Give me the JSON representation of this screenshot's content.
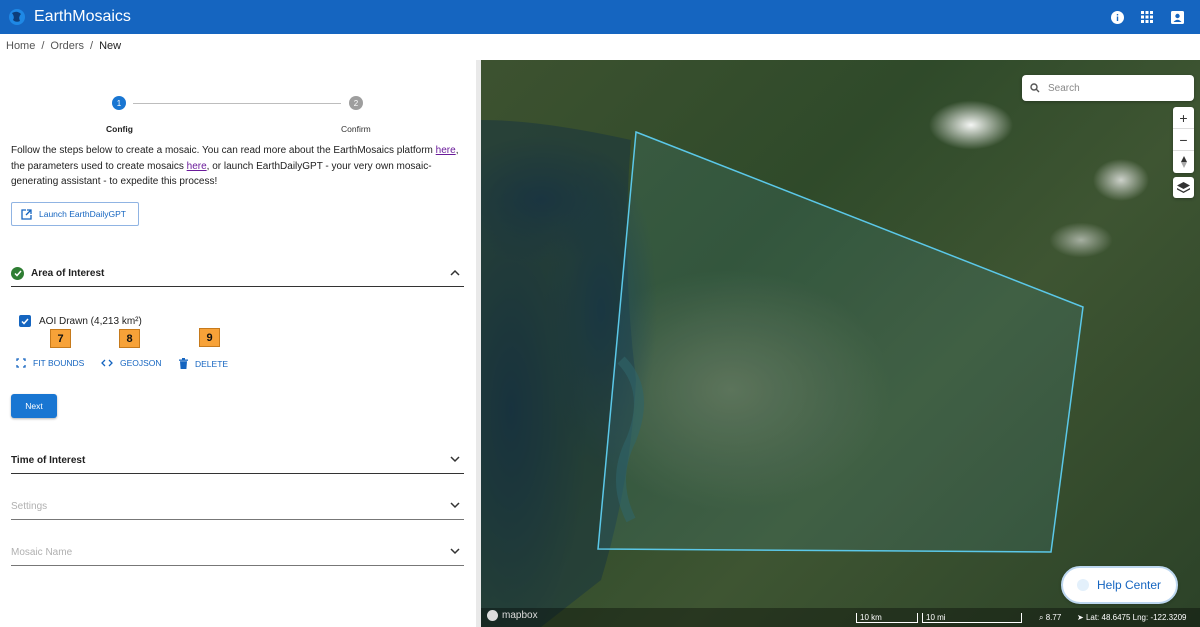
{
  "app": {
    "title": "EarthMosaics"
  },
  "breadcrumb": {
    "items": [
      "Home",
      "Orders",
      "New"
    ],
    "separator": "/"
  },
  "stepper": {
    "steps": [
      {
        "number": "1",
        "label": "Config",
        "active": true
      },
      {
        "number": "2",
        "label": "Confirm",
        "active": false
      }
    ]
  },
  "intro": {
    "part1": "Follow the steps below to create a mosaic. You can read more about the EarthMosaics platform ",
    "link1": "here",
    "part2": ", the parameters used to create mosaics ",
    "link2": "here",
    "part3": ", or launch EarthDailyGPT - your very own mosaic-generating assistant - to expedite this process!"
  },
  "launch_button": {
    "label": "Launch EarthDailyGPT"
  },
  "area_of_interest": {
    "title": "Area of Interest",
    "aoi_label": "AOI Drawn (4,213 km²)",
    "actions": {
      "fit_bounds": "FIT BOUNDS",
      "geojson": "GEOJSON",
      "delete": "DELETE"
    },
    "badges": [
      "7",
      "8",
      "9"
    ]
  },
  "next_button": {
    "label": "Next"
  },
  "sections": {
    "time_of_interest": "Time of Interest",
    "settings": "Settings",
    "mosaic_name": "Mosaic Name"
  },
  "map": {
    "search_placeholder": "Search",
    "zoom_in": "+",
    "zoom_out": "−",
    "attribution": "mapbox",
    "scale_km": "10 km",
    "scale_mi": "10 mi",
    "zoom_level": "8.77",
    "coordinates": "Lat: 48.6475 Lng: -122.3209",
    "help_center": "Help Center"
  },
  "colors": {
    "primary": "#1565c0",
    "success": "#2e7d32",
    "badge": "#f7a238",
    "aoi_outline": "#5bc8e8"
  }
}
